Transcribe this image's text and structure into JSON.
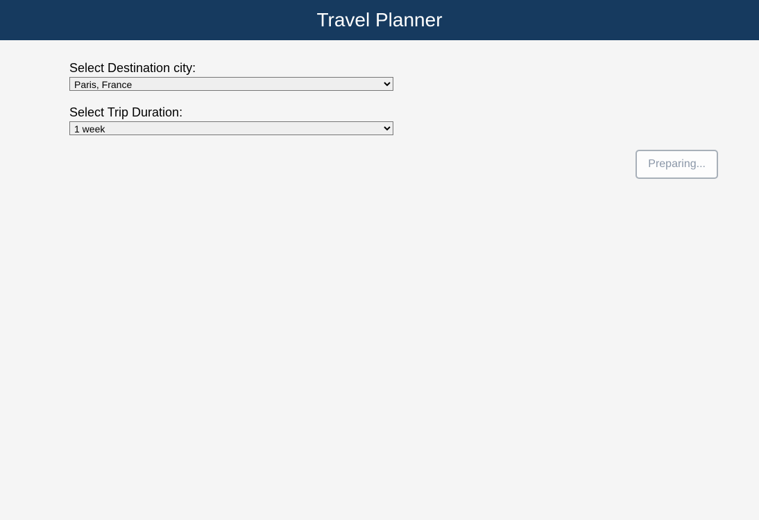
{
  "header": {
    "title": "Travel Planner"
  },
  "form": {
    "destination": {
      "label": "Select Destination city:",
      "selected": "Paris, France"
    },
    "duration": {
      "label": "Select Trip Duration:",
      "selected": "1 week"
    }
  },
  "button": {
    "label": "Preparing..."
  }
}
